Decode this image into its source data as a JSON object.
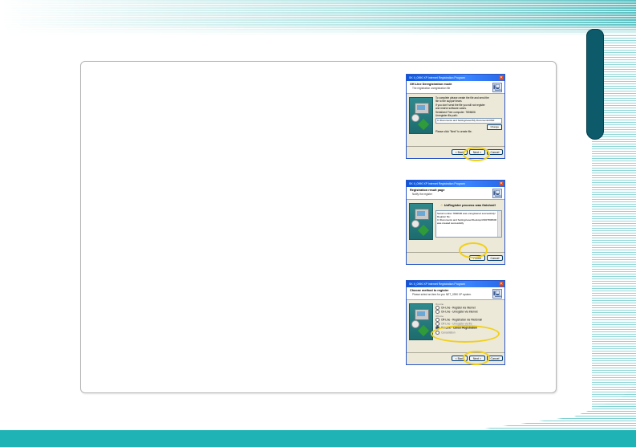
{
  "dialogs": [
    {
      "title": "SK II_0990 XP Internet Registration Program",
      "header_title": "Off-Line Deregistration mode",
      "header_sub": "The registration unregistration file",
      "text_lines": [
        "To complete please create the file and send the",
        "file to the support team.",
        "If you don't send the file you will not register",
        "and restrict software cases."
      ],
      "serial_label": "Serialized Free computer: 7806606",
      "path_label": "Unregister file path:",
      "path_value": "C:\\Documents and Settings\\user\\My Documents\\UNR",
      "change_label": "Change",
      "footer_hint": "Please click \"Next\" to create file.",
      "buttons": {
        "back": "< Back",
        "next": "Next >",
        "cancel": "Cancel"
      }
    },
    {
      "title": "SK II_0990 XP Internet Registration Program",
      "header_title": "Registration result page",
      "header_sub": "Notify the register",
      "message": "UnRegister process was finished!",
      "log_lines": [
        "Serial number 7806606 was unregistered successfully!",
        "Register file:",
        "C:\\Documents and Settings\\user\\Desktop\\UNR7806606",
        "was created successfully"
      ],
      "buttons": {
        "next": "Finish",
        "cancel": "Cancel"
      }
    },
    {
      "title": "SK II_0990 XP Internet Registration Program",
      "header_title": "Choose method to register",
      "header_sub": "Please select an item for you NET_0990 XP system.",
      "online_label": "On-Line",
      "offline_label": "Off-Line",
      "options": [
        "On-Line - Register via Internet",
        "On-Line - Unregister via Internet",
        "Off-Line - Registration via File/Email",
        "Off-Line - Unregister via file",
        "Off Line - Cancel Registration",
        "Cancellation"
      ],
      "buttons": {
        "back": "< Back",
        "next": "Next >",
        "cancel": "Cancel"
      }
    }
  ],
  "colors": {
    "teal": "#1fb3b6",
    "dark_tab": "#0d5a6b",
    "highlight": "#f2d016",
    "xp_blue": "#0a55dd"
  }
}
